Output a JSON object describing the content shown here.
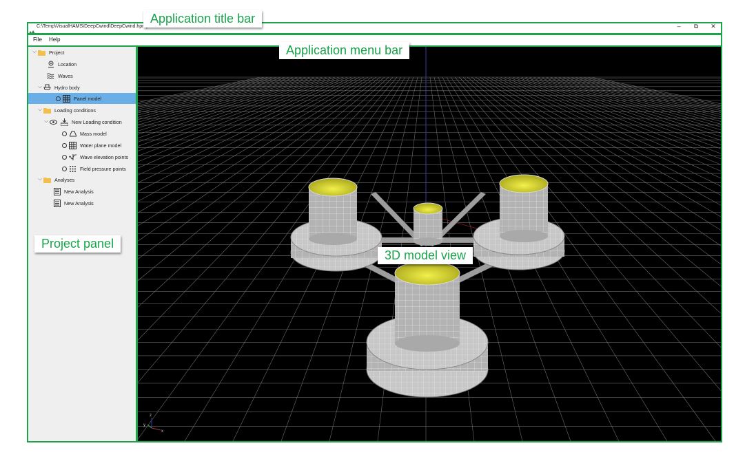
{
  "window": {
    "title": "C:\\Temp\\VisualHAMS\\DeepCwind\\DeepCwind.hproj",
    "buttons": [
      "–",
      "⧉",
      "✕"
    ]
  },
  "menu": {
    "items": [
      "File",
      "Help"
    ]
  },
  "project_tree": {
    "project": "Project",
    "location": "Location",
    "waves": "Waves",
    "hydro_body": "Hydro body",
    "panel_model": "Panel model",
    "loading_conditions": "Loading conditions",
    "new_loading_condition": "New Loading condition",
    "mass_model": "Mass model",
    "water_plane_model": "Water plane model",
    "wave_elevation_points": "Wave elevation points",
    "field_pressure_points": "Field pressure points",
    "analyses": "Analyses",
    "analysis_1": "New Analysis",
    "analysis_2": "New Analysis"
  },
  "axes": {
    "x": "x",
    "y": "y",
    "z": "z"
  },
  "callouts": {
    "title_bar": "Application title bar",
    "menu_bar": "Application menu bar",
    "project_panel": "Project panel",
    "model_view": "3D model view"
  },
  "colors": {
    "annotation": "#1fa34a",
    "selection": "#6aaee8",
    "viewport_bg": "#000000",
    "column_top": "#e3e033",
    "hull": "#b9b9b9"
  }
}
